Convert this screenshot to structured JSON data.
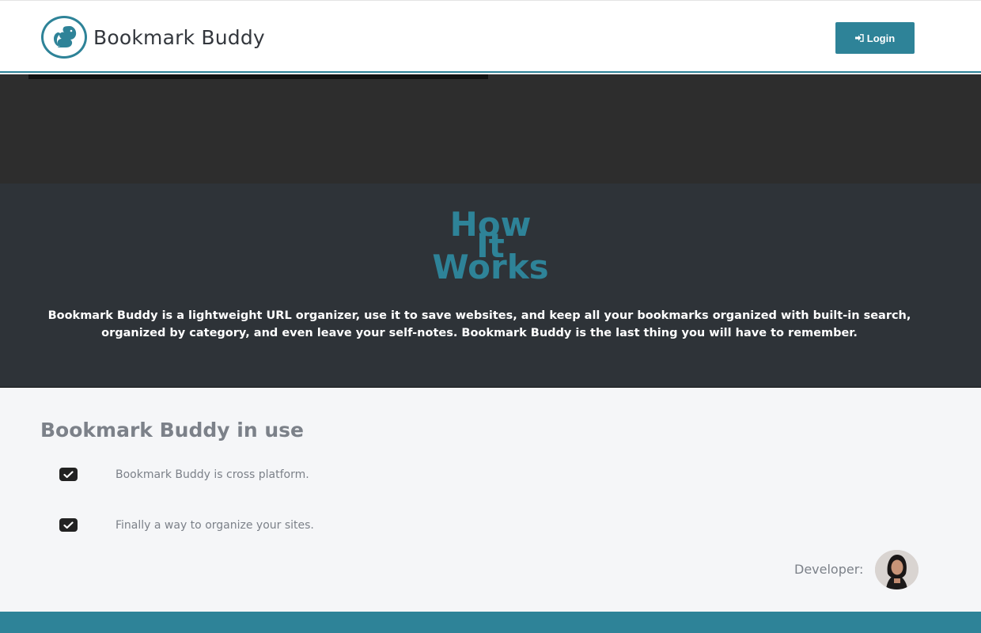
{
  "header": {
    "brand_name": "Bookmark Buddy",
    "login_label": "Login",
    "logo_icon": "squirrel-icon",
    "login_icon": "sign-in-icon"
  },
  "how_it_works": {
    "title_lines": [
      "How",
      "It",
      "Works"
    ],
    "description": "Bookmark Buddy is a lightweight URL organizer, use it to save websites, and keep all your bookmarks organized with built-in search, organized by category, and even leave your self-notes. Bookmark Buddy is the last thing you will have to remember."
  },
  "in_use": {
    "title": "Bookmark Buddy in use",
    "features": [
      {
        "label": "Bookmark Buddy is cross platform.",
        "icon": "check-square-icon"
      },
      {
        "label": "Finally a way to organize your sites.",
        "icon": "check-square-icon"
      }
    ],
    "developer_label": "Developer:"
  },
  "colors": {
    "accent": "#2e8398",
    "hero_bg": "#2d2d2d",
    "how_bg": "#2e3338",
    "section_bg": "#f5f6f8"
  }
}
